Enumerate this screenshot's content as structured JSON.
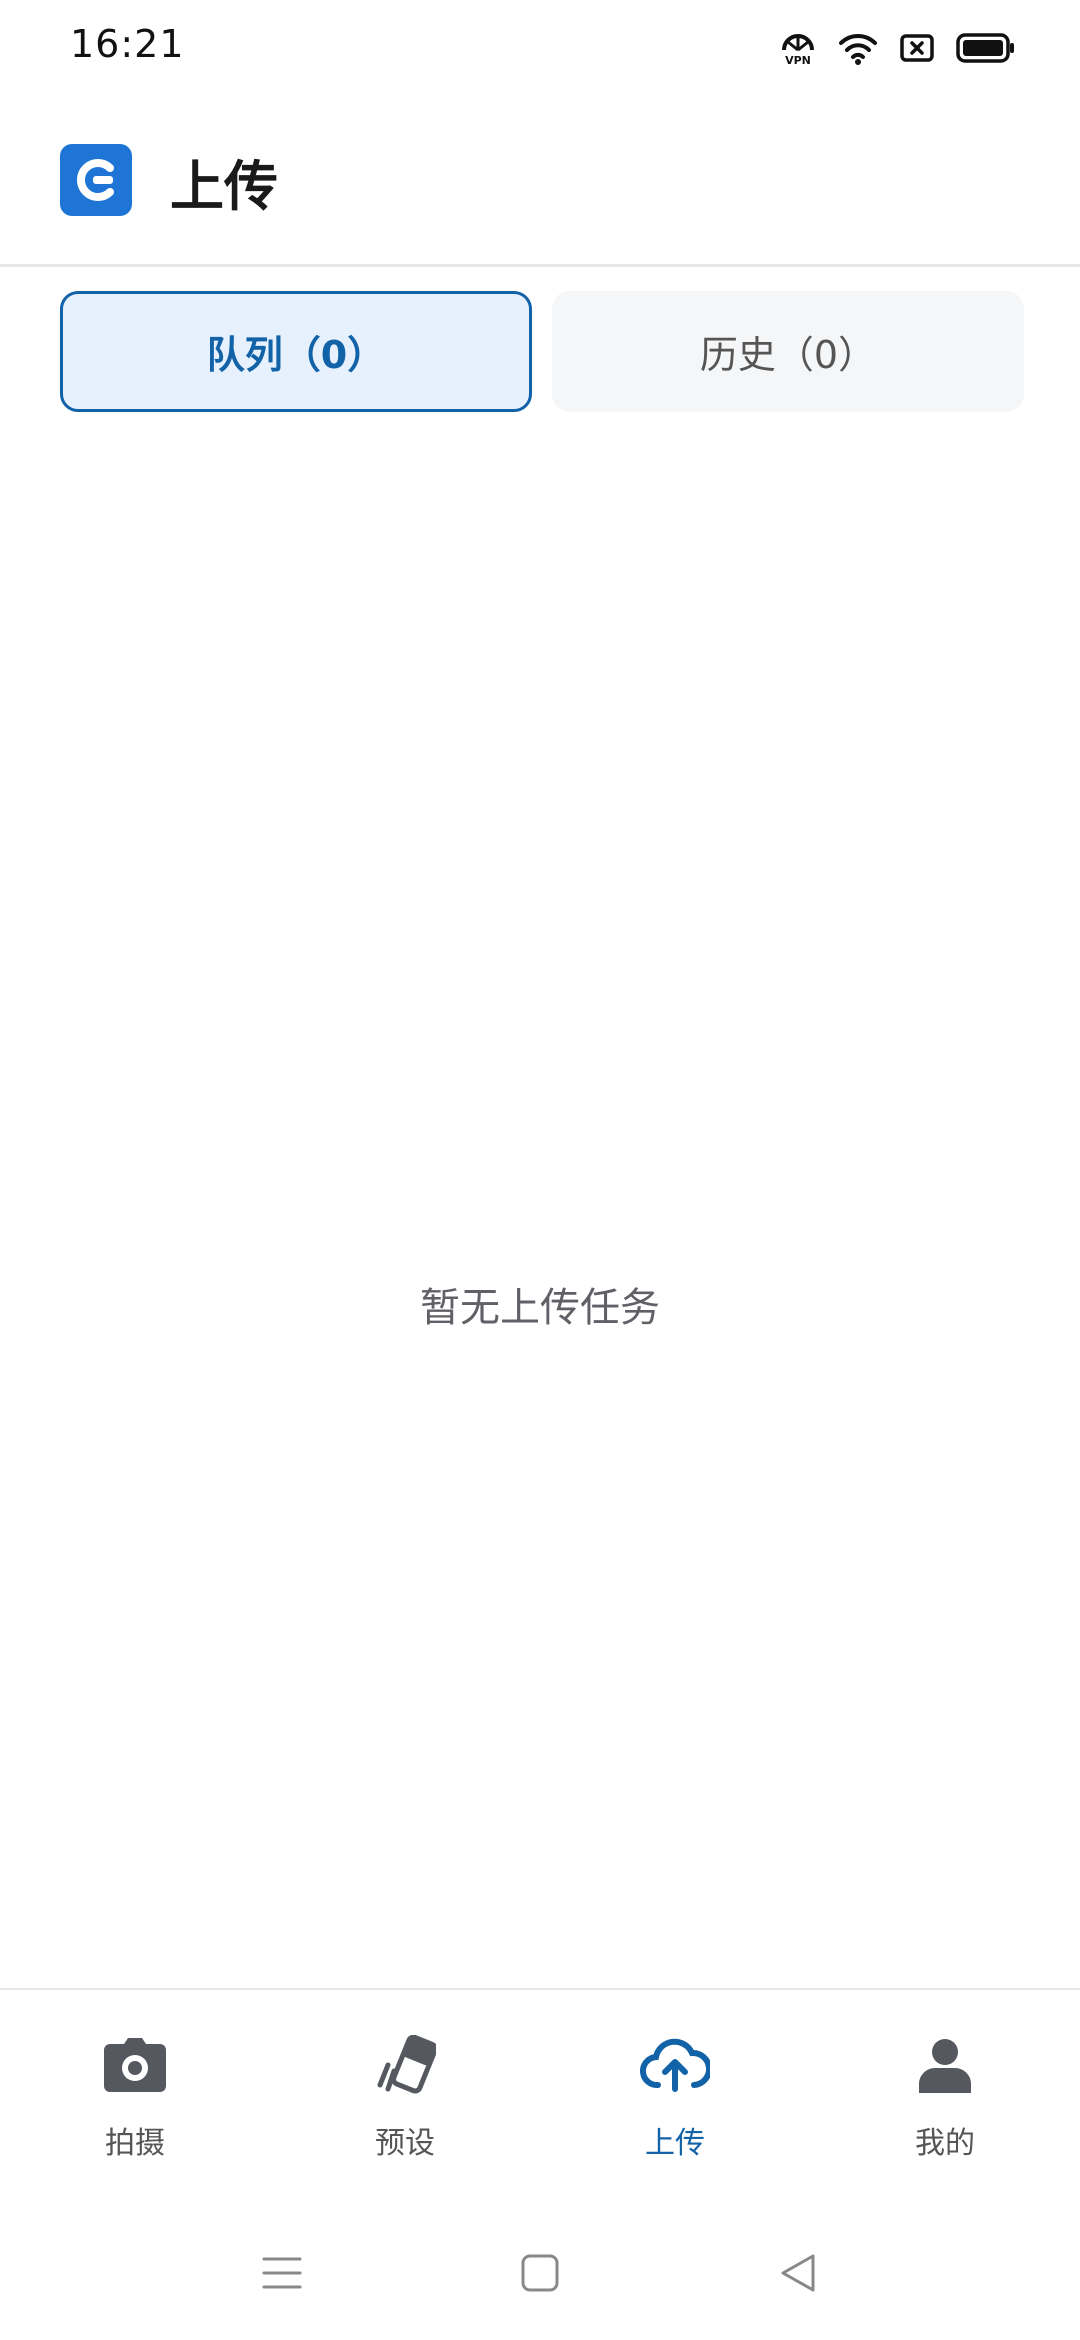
{
  "status_bar": {
    "time": "16:21",
    "icons": [
      "vpn-icon",
      "wifi-icon",
      "sim-off-icon",
      "battery-icon"
    ]
  },
  "header": {
    "logo_icon": "app-logo-icon",
    "title": "上传"
  },
  "tabs": [
    {
      "label": "队列（0）",
      "active": true
    },
    {
      "label": "历史（0）",
      "active": false
    }
  ],
  "main": {
    "empty_text": "暂无上传任务"
  },
  "bottom_nav": {
    "items": [
      {
        "label": "拍摄",
        "icon": "camera-icon",
        "active": false
      },
      {
        "label": "预设",
        "icon": "presets-icon",
        "active": false
      },
      {
        "label": "上传",
        "icon": "cloud-upload-icon",
        "active": true
      },
      {
        "label": "我的",
        "icon": "person-icon",
        "active": false
      }
    ]
  },
  "system_nav": {
    "icons": [
      "menu-icon",
      "home-icon",
      "back-icon"
    ]
  },
  "colors": {
    "accent": "#1262a8",
    "accent_bg": "#e6f1fd",
    "logo_blue": "#1f75d6",
    "inactive_text": "#555555"
  }
}
